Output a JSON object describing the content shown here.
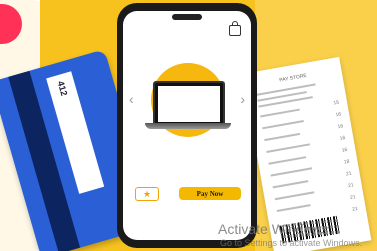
{
  "card": {
    "code": "412"
  },
  "receipt": {
    "title": "PAY STORE",
    "lines": [
      "15",
      "16",
      "16",
      "16",
      "16",
      "18",
      "21",
      "21",
      "21",
      "21"
    ]
  },
  "phone": {
    "pay_label": "Pay Now",
    "star_icon": "star-icon",
    "bag_icon": "shopping-bag-icon",
    "prev_icon": "chevron-left-icon",
    "next_icon": "chevron-right-icon",
    "product": "laptop"
  },
  "watermark": {
    "title": "Activate Windows",
    "subtitle": "Go to Settings to activate Windows."
  },
  "colors": {
    "background_yellow": "#f7c21e",
    "accent_red": "#ff3157",
    "card_blue": "#2a5fd6",
    "button_yellow": "#f5b800"
  }
}
